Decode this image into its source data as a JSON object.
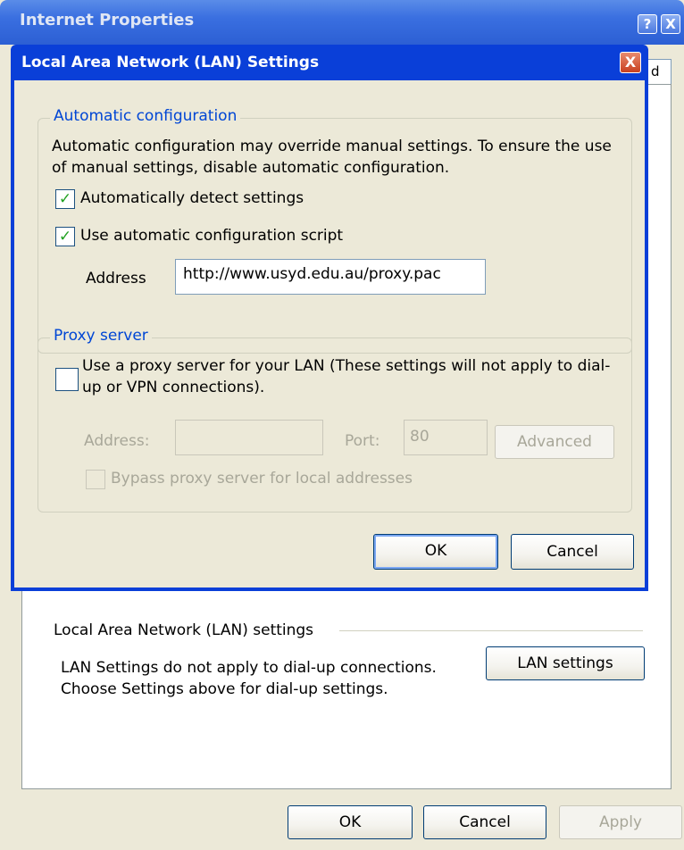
{
  "outer_window": {
    "title": "Internet Properties",
    "help_button": "?",
    "close_button": "X",
    "tab_fragment": "d",
    "lan_section": {
      "title": "Local Area Network (LAN) settings",
      "description_line1": "LAN Settings do not apply to dial-up connections.",
      "description_line2": "Choose Settings above for dial-up settings.",
      "lan_settings_button": "LAN settings"
    },
    "buttons": {
      "ok": "OK",
      "cancel": "Cancel",
      "apply": "Apply"
    }
  },
  "lan_dialog": {
    "title": "Local Area Network (LAN) Settings",
    "close_button": "X",
    "automatic_configuration": {
      "legend": "Automatic configuration",
      "description": "Automatic configuration may override manual settings.  To ensure the use of manual settings, disable automatic configuration.",
      "detect_settings": {
        "label": "Automatically detect settings",
        "checked": true
      },
      "use_script": {
        "label": "Use automatic configuration script",
        "checked": true
      },
      "address_label": "Address",
      "address_value": "http://www.usyd.edu.au/proxy.pac"
    },
    "proxy_server": {
      "legend": "Proxy server",
      "use_proxy": {
        "label": "Use a proxy server for your LAN (These settings will not apply to dial-up or VPN connections).",
        "checked": false
      },
      "address_label": "Address:",
      "address_value": "",
      "port_label": "Port:",
      "port_value": "80",
      "advanced_button": "Advanced",
      "bypass_local": {
        "label": "Bypass proxy server for local addresses",
        "checked": false
      }
    },
    "buttons": {
      "ok": "OK",
      "cancel": "Cancel"
    }
  },
  "colors": {
    "title_blue": "#0a3fd8",
    "dialog_face": "#ece9d8",
    "group_legend": "#0046d5",
    "check_green": "#21a121",
    "disabled_text": "#a8a799"
  },
  "icons": {
    "check": "check-icon",
    "help": "help-icon",
    "close": "close-icon"
  }
}
